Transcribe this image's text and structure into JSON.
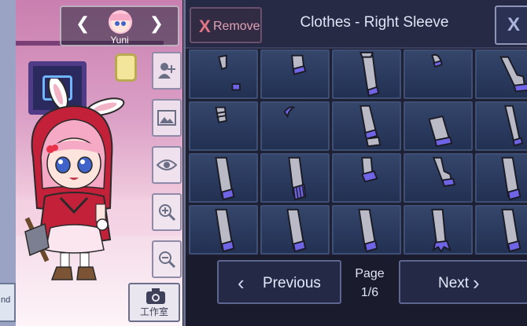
{
  "character": {
    "name": "Yuni"
  },
  "toolbar": {
    "camera_label": "工作室"
  },
  "panel": {
    "remove_label": "Remove",
    "title": "Clothes - Right Sleeve",
    "close_label": "X",
    "previous_label": "Previous",
    "next_label": "Next",
    "page_label": "Page",
    "page_value": "1/6"
  },
  "left_strip_text": "nd",
  "colors": {
    "panel_bg": "#1e2034",
    "cell_bg": "#2f4065",
    "sleeve_gray": "#b9bac6",
    "sleeve_accent": "#6f63e6",
    "hood_red": "#c3203a",
    "hair_pink": "#f6a9c4"
  },
  "items": [
    {
      "id": 1,
      "kind": "small-cuff"
    },
    {
      "id": 2,
      "kind": "short-sleeve"
    },
    {
      "id": 3,
      "kind": "long-sleeve"
    },
    {
      "id": 4,
      "kind": "tiny-cap"
    },
    {
      "id": 5,
      "kind": "frilled-cuff"
    },
    {
      "id": 6,
      "kind": "frilled-glove"
    },
    {
      "id": 7,
      "kind": "thin-hook"
    },
    {
      "id": 8,
      "kind": "banded-sleeve"
    },
    {
      "id": 9,
      "kind": "wide-sleeve"
    },
    {
      "id": 10,
      "kind": "slim-sleeve"
    },
    {
      "id": 11,
      "kind": "long-sleeve-tip"
    },
    {
      "id": 12,
      "kind": "long-sleeve-ribbed"
    },
    {
      "id": 13,
      "kind": "short-bell"
    },
    {
      "id": 14,
      "kind": "bent-sleeve"
    },
    {
      "id": 15,
      "kind": "long-sleeve-tip"
    },
    {
      "id": 16,
      "kind": "long-sleeve-tip"
    },
    {
      "id": 17,
      "kind": "long-sleeve-tip"
    },
    {
      "id": 18,
      "kind": "long-sleeve-tip"
    },
    {
      "id": 19,
      "kind": "lace-cuff"
    },
    {
      "id": 20,
      "kind": "long-sleeve-tip"
    }
  ]
}
